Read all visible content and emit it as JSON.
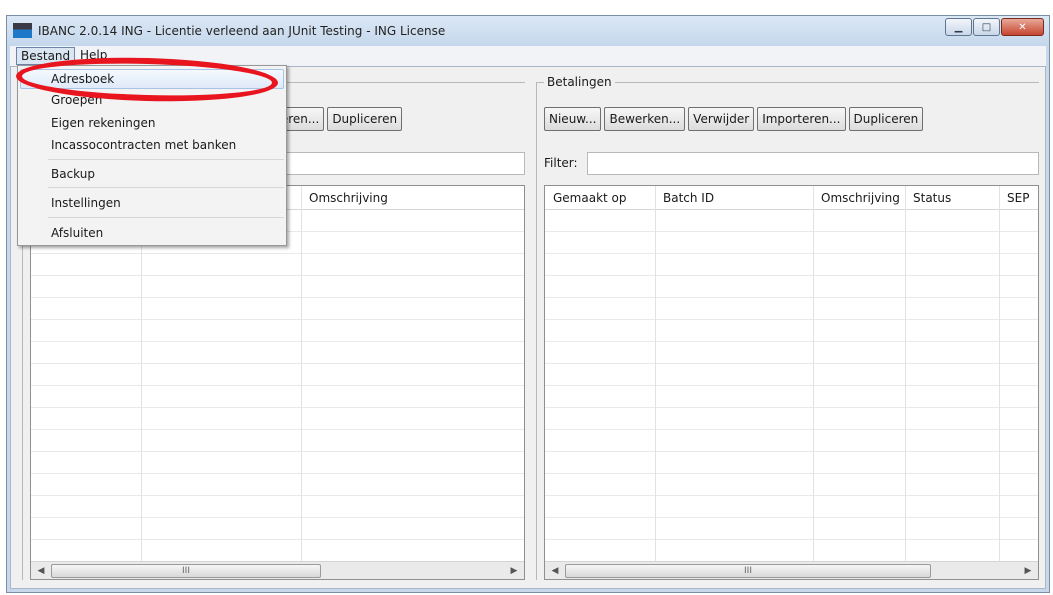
{
  "window": {
    "title": "IBANC 2.0.14 ING - Licentie verleend aan JUnit Testing - ING License",
    "minimize_glyph": "▁",
    "maximize_glyph": "□",
    "close_glyph": "✕"
  },
  "menubar": {
    "bestand": "Bestand",
    "help": "Help"
  },
  "bestand_menu": {
    "items": [
      "Adresboek",
      "Groepen",
      "Eigen rekeningen",
      "Incassocontracten met banken",
      "Backup",
      "Instellingen",
      "Afsluiten"
    ]
  },
  "left_panel": {
    "buttons": {
      "importeren": "Importeren...",
      "dupliceren": "Dupliceren"
    },
    "columns": [
      "",
      "",
      "Omschrijving"
    ]
  },
  "right_panel": {
    "group_title": "Betalingen",
    "buttons": {
      "nieuw": "Nieuw...",
      "bewerken": "Bewerken...",
      "verwijder": "Verwijder",
      "importeren": "Importeren...",
      "dupliceren": "Dupliceren"
    },
    "filter_label": "Filter:",
    "columns": [
      "Gemaakt op",
      "Batch ID",
      "Omschrijving",
      "Status",
      "SEP"
    ]
  },
  "scrollbar": {
    "left_arrow": "◀",
    "right_arrow": "▶",
    "grip": "III"
  },
  "annotation": {
    "highlight_color": "#e8141e"
  }
}
